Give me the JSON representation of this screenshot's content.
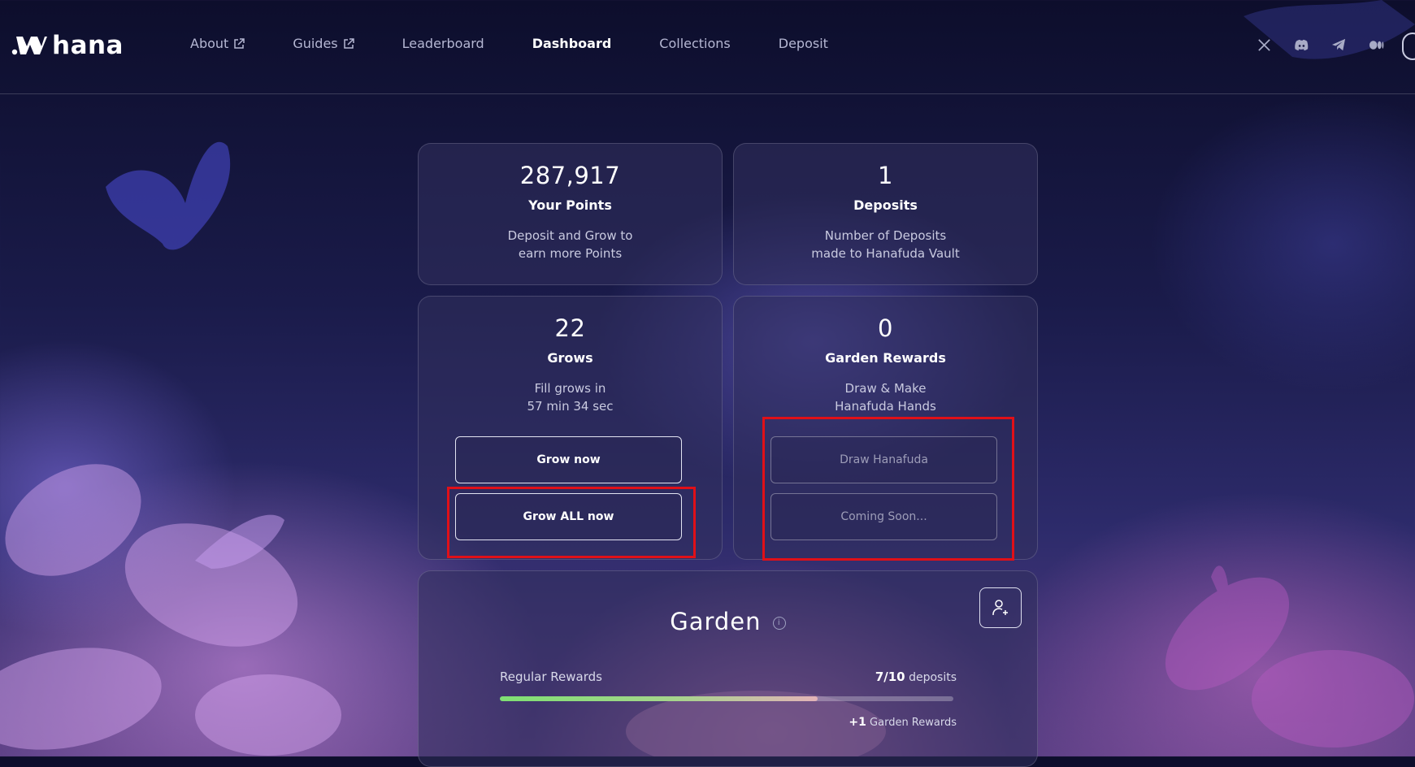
{
  "brand": {
    "name": "hana"
  },
  "nav": [
    {
      "label": "About",
      "external": true
    },
    {
      "label": "Guides",
      "external": true
    },
    {
      "label": "Leaderboard",
      "external": false
    },
    {
      "label": "Dashboard",
      "external": false,
      "active": true
    },
    {
      "label": "Collections",
      "external": false
    },
    {
      "label": "Deposit",
      "external": false
    }
  ],
  "socials": [
    "x-icon",
    "discord-icon",
    "telegram-icon",
    "medium-icon"
  ],
  "cards": {
    "points": {
      "value": "287,917",
      "label": "Your Points",
      "description": "Deposit and Grow to\nearn more Points"
    },
    "deposits": {
      "value": "1",
      "label": "Deposits",
      "description": "Number of Deposits\nmade to Hanafuda Vault"
    },
    "grows": {
      "value": "22",
      "label": "Grows",
      "description": "Fill grows in\n57 min 34 sec",
      "grow_now": "Grow now",
      "grow_all": "Grow ALL now"
    },
    "garden_rewards": {
      "value": "0",
      "label": "Garden Rewards",
      "description": "Draw & Make\nHanafuda Hands",
      "draw": "Draw Hanafuda",
      "coming_soon": "Coming Soon..."
    }
  },
  "garden": {
    "title": "Garden",
    "info_glyph": "i",
    "regular_rewards_label": "Regular Rewards",
    "count": "7/10",
    "count_unit": "deposits",
    "progress": 0.7,
    "reward_amount": "+1",
    "reward_label": "Garden Rewards"
  },
  "colors": {
    "highlight": "#e01018",
    "progress_start": "#7fe073",
    "progress_end": "#e3b3b8"
  }
}
